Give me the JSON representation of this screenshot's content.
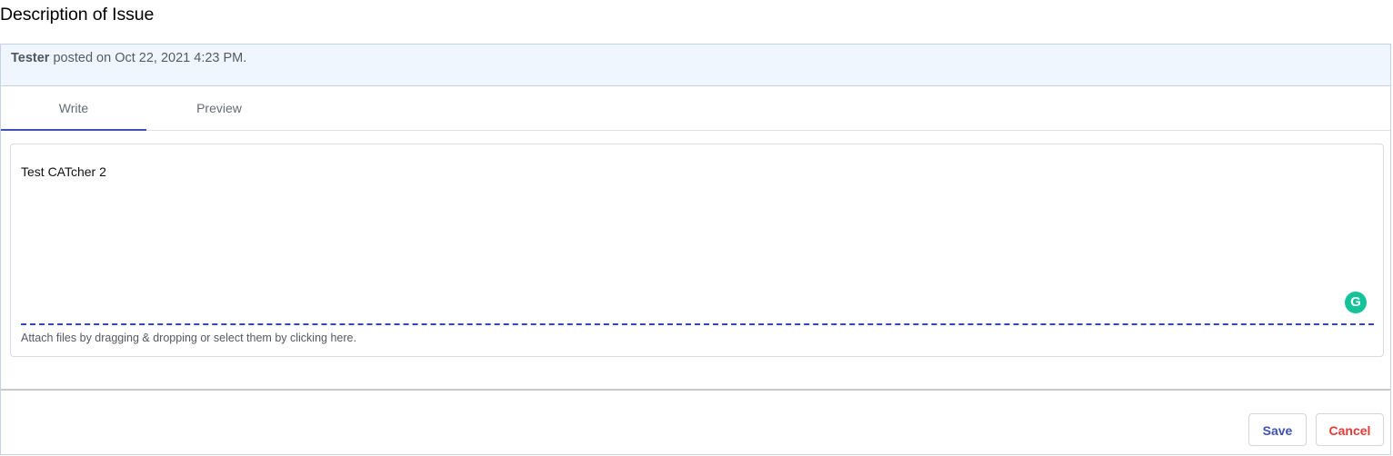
{
  "page_title": "Description of Issue",
  "comment": {
    "author": "Tester",
    "posted_text": " posted on Oct 22, 2021 4:23 PM."
  },
  "tabs": [
    {
      "label": "Write",
      "active": true
    },
    {
      "label": "Preview",
      "active": false
    }
  ],
  "editor": {
    "content": "Test CATcher 2",
    "grammarly_icon": "G",
    "attach_hint": "Attach files by dragging & dropping or select them by clicking here."
  },
  "actions": {
    "save_label": "Save",
    "cancel_label": "Cancel"
  },
  "colors": {
    "accent": "#3f51b5",
    "cancel": "#e53935",
    "header_bg": "#f0f6fd",
    "grammarly": "#15c39a"
  }
}
